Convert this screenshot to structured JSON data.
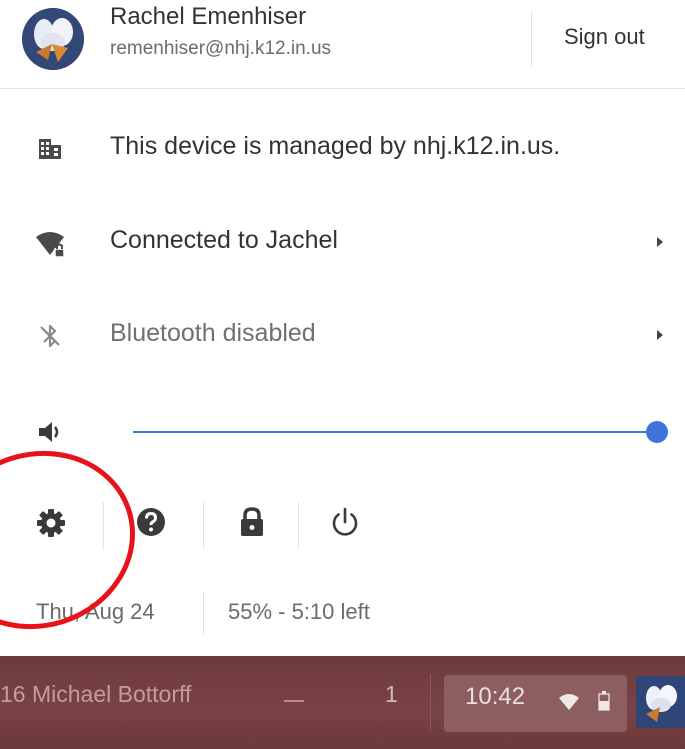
{
  "user": {
    "name": "Rachel Emenhiser",
    "email": "remenhiser@nhj.k12.in.us",
    "sign_out_label": "Sign out"
  },
  "rows": {
    "managed": {
      "label": "This device is managed by nhj.k12.in.us.",
      "icon": "building-icon"
    },
    "network": {
      "label": "Connected to Jachel",
      "icon": "wifi-lock-icon"
    },
    "bluetooth": {
      "label": "Bluetooth disabled",
      "icon": "bluetooth-disabled-icon"
    }
  },
  "volume": {
    "level_percent": 100,
    "icon": "volume-icon"
  },
  "actions": [
    "settings-icon",
    "help-icon",
    "lock-icon",
    "power-icon"
  ],
  "status": {
    "date": "Thu, Aug 24",
    "battery": "55% - 5:10 left"
  },
  "shelf": {
    "app_title": "16 Michael Bottorff",
    "window_count": "1",
    "time": "10:42"
  },
  "colors": {
    "accent": "#3f73d8",
    "annotation": "#e8121a",
    "shelf": "#7a4345"
  }
}
